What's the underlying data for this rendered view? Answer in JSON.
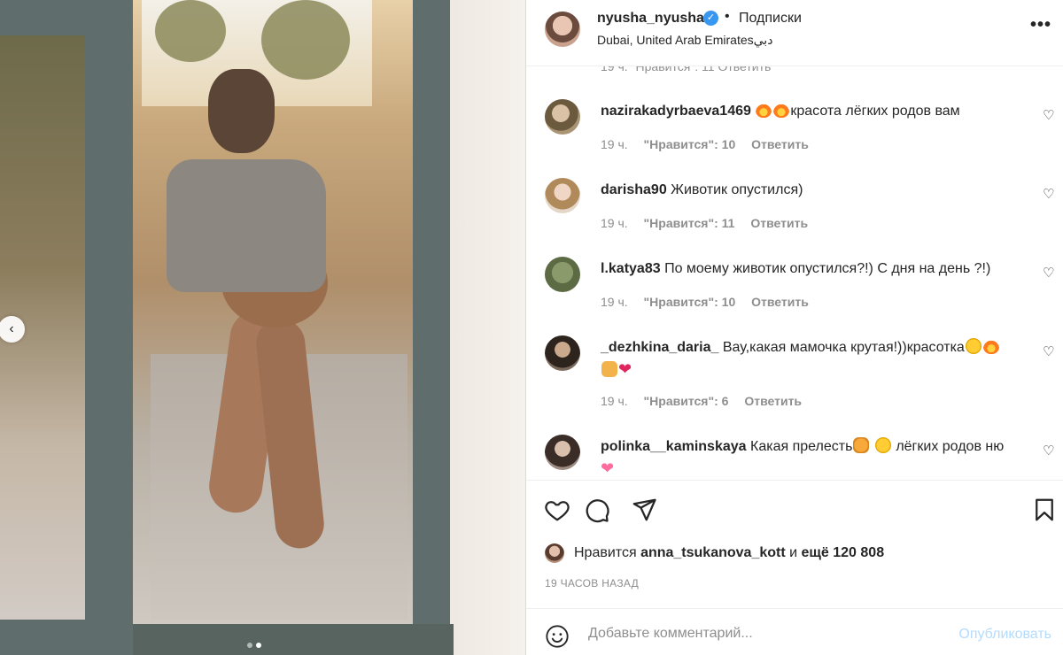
{
  "header": {
    "username": "nyusha_nyusha",
    "bullet": "•",
    "follow_label": "Подписки",
    "location": "Dubai, United Arab Emiratesدبي",
    "more_label": "•••"
  },
  "carousel": {
    "prev_label": "‹",
    "slide_count": 2,
    "active_slide": 2
  },
  "comments": {
    "peek_text": "19 ч.    \"Нравится\": 11    Ответить",
    "items": [
      {
        "username": "nazirakadyrbaeva1469",
        "text": "красота лёгких родов вам",
        "time": "19 ч.",
        "likes": "\"Нравится\": 10",
        "reply": "Ответить",
        "emoji_before": [
          "fire",
          "fire"
        ],
        "emoji_after": []
      },
      {
        "username": "darisha90",
        "text": "Животик опустился)",
        "time": "19 ч.",
        "likes": "\"Нравится\": 11",
        "reply": "Ответить"
      },
      {
        "username": "l.katya83",
        "text": "По моему животик опустился?!) С дня на день ?!)",
        "time": "19 ч.",
        "likes": "\"Нравится\": 10",
        "reply": "Ответить"
      },
      {
        "username": "_dezhkina_daria_",
        "text": "Вау,какая мамочка крутая!))красотка",
        "time": "19 ч.",
        "likes": "\"Нравится\": 6",
        "reply": "Ответить"
      },
      {
        "username": "polinka__kaminskaya",
        "text_a": "Какая прелесть",
        "text_b": "лёгких родов ню",
        "time": "",
        "likes": "",
        "reply": ""
      }
    ]
  },
  "actions": {
    "like_icon": "heart-icon",
    "comment_icon": "comment-icon",
    "share_icon": "paper-plane-icon",
    "save_icon": "bookmark-icon"
  },
  "likes": {
    "prefix": "Нравится",
    "user": "anna_tsukanova_kott",
    "middle": "и",
    "count": "ещё 120 808"
  },
  "timestamp": "19 ЧАСОВ НАЗАД",
  "add_comment": {
    "placeholder": "Добавьте комментарий...",
    "publish_label": "Опубликовать"
  },
  "colors": {
    "verified": "#3897f0",
    "publish_disabled": "#b3dbff",
    "meta_gray": "#8e8e8e"
  }
}
